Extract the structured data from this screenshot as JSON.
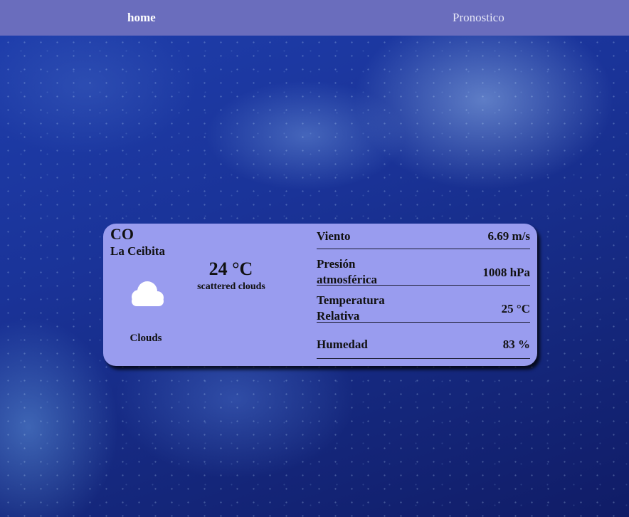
{
  "nav": {
    "home_label": "home",
    "forecast_label": "Pronostico"
  },
  "weather": {
    "country": "CO",
    "city": "La Ceibita",
    "icon": "cloud-icon",
    "condition": "Clouds",
    "temperature": "24 °C",
    "description": "scattered clouds"
  },
  "stats": [
    {
      "label": "Viento",
      "value": "6.69 m/s"
    },
    {
      "label": "Presión atmosférica",
      "value": "1008 hPa"
    },
    {
      "label": "Temperatura Relativa",
      "value": "25 °C"
    },
    {
      "label": "Humedad",
      "value": "83 %"
    }
  ],
  "colors": {
    "navbar": "#6a6dbd",
    "card": "#999cef",
    "background": "#1a3398"
  }
}
